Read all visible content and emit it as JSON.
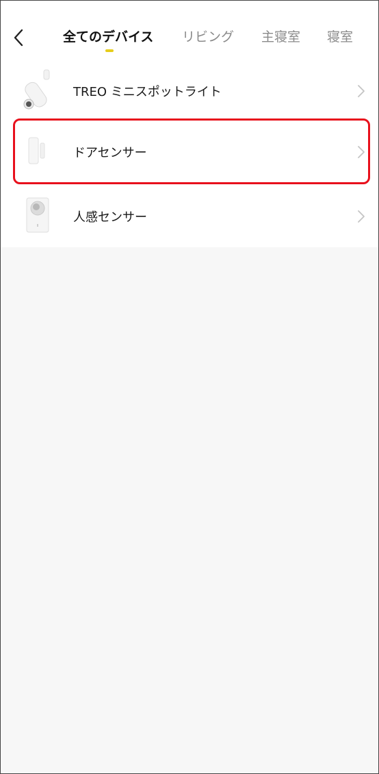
{
  "header": {
    "back_icon": "chevron-left-icon",
    "tabs": [
      {
        "label": "全てのデバイス",
        "active": true
      },
      {
        "label": "リビング",
        "active": false
      },
      {
        "label": "主寝室",
        "active": false
      },
      {
        "label": "寝室",
        "active": false
      }
    ],
    "indicator_color": "#e6cd1c"
  },
  "devices": [
    {
      "label": "TREO ミニスポットライト",
      "icon": "spotlight-icon"
    },
    {
      "label": "ドアセンサー",
      "icon": "door-sensor-icon"
    },
    {
      "label": "人感センサー",
      "icon": "motion-sensor-icon"
    }
  ],
  "highlight_color": "#e8101c"
}
